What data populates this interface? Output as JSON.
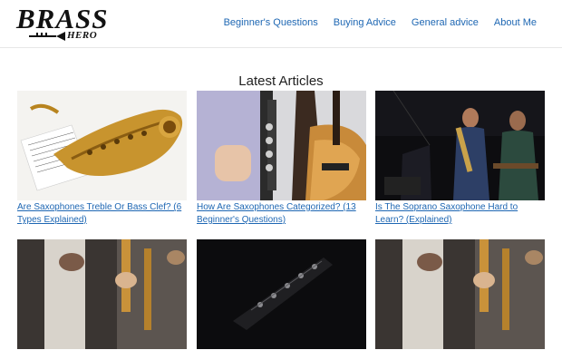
{
  "logo": {
    "main": "BRASS",
    "sub": "HERO"
  },
  "nav": [
    {
      "label": "Beginner's Questions"
    },
    {
      "label": "Buying Advice"
    },
    {
      "label": "General advice"
    },
    {
      "label": "About Me"
    }
  ],
  "section_title": "Latest Articles",
  "articles": [
    {
      "title": "Are Saxophones Treble Or Bass Clef? (6 Types Explained)"
    },
    {
      "title": "How Are Saxophones Categorized? (13 Beginner's Questions)"
    },
    {
      "title": "Is The Soprano Saxophone Hard to Learn? (Explained)"
    },
    {
      "title": ""
    },
    {
      "title": ""
    },
    {
      "title": ""
    }
  ],
  "colors": {
    "link": "#1e67b3",
    "text": "#222222"
  }
}
